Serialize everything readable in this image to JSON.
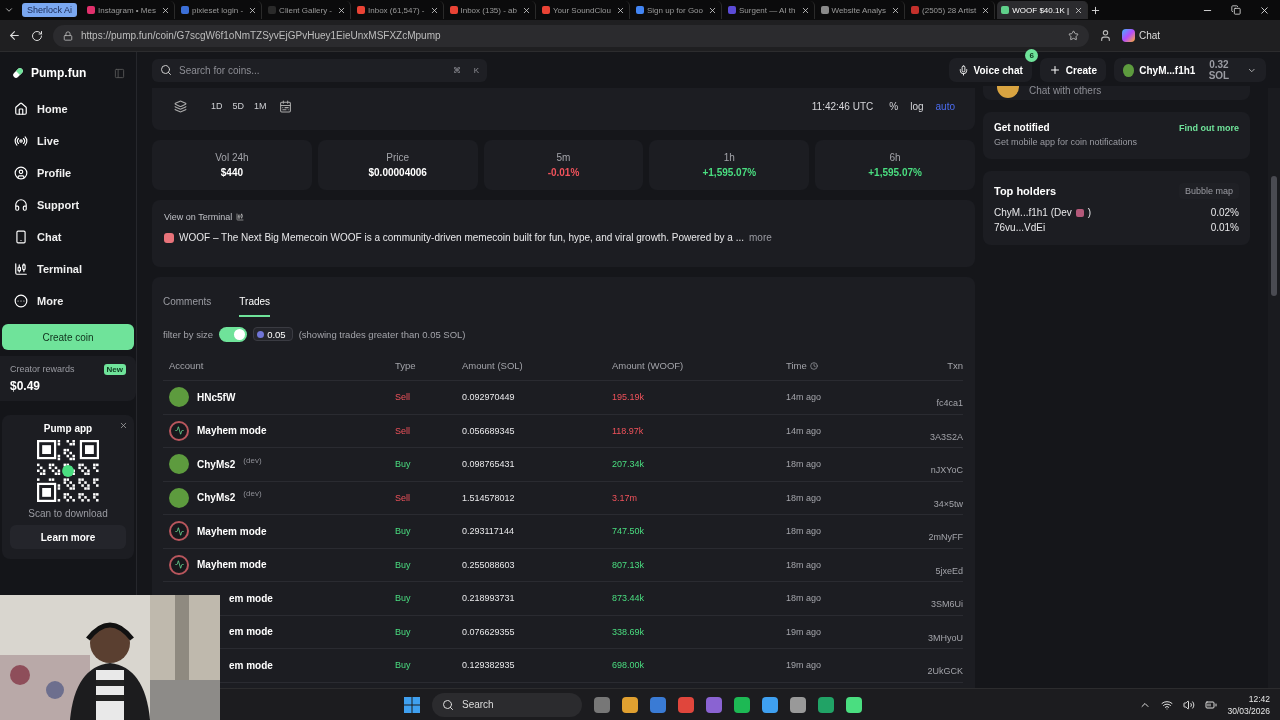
{
  "browser": {
    "group_label": "Sherlock Ai",
    "tabs": [
      {
        "title": "Instagram • Mes",
        "color": "#e1306c",
        "selected": false
      },
      {
        "title": "pixieset login -",
        "color": "#3b6fd8",
        "selected": false
      },
      {
        "title": "Client Gallery -",
        "color": "#2a2a2a",
        "selected": false
      },
      {
        "title": "Inbox (61,547) -",
        "color": "#ea4335",
        "selected": false
      },
      {
        "title": "Inbox (135) - ab",
        "color": "#ea4335",
        "selected": false
      },
      {
        "title": "Your SoundClou",
        "color": "#ea4335",
        "selected": false
      },
      {
        "title": "Sign up for Goo",
        "color": "#4285f4",
        "selected": false
      },
      {
        "title": "Surgent — AI th",
        "color": "#5b4bd6",
        "selected": false
      },
      {
        "title": "Website Analys",
        "color": "#8a8a8a",
        "selected": false
      },
      {
        "title": "(2505) 28 Artist",
        "color": "#c4302b",
        "selected": false
      },
      {
        "title": "WOOF $40.1K |",
        "color": "#5fd08a",
        "selected": true
      }
    ],
    "url": "https://pump.fun/coin/G7scgW6f1oNmTZSyvEjGPvHuey1EieUnxMSFXZcMpump",
    "chat_button": "Chat"
  },
  "sidebar": {
    "logo": "Pump.fun",
    "items": [
      {
        "label": "Home"
      },
      {
        "label": "Live"
      },
      {
        "label": "Profile"
      },
      {
        "label": "Support"
      },
      {
        "label": "Chat"
      },
      {
        "label": "Terminal"
      },
      {
        "label": "More"
      }
    ],
    "create_button": "Create coin",
    "rewards": {
      "label": "Creator rewards",
      "badge": "New",
      "amount": "$0.49"
    },
    "app_card": {
      "title": "Pump app",
      "caption": "Scan to download",
      "button": "Learn more"
    }
  },
  "header": {
    "search_placeholder": "Search for coins...",
    "shortcut": [
      "⌘",
      "K"
    ],
    "voice_chat": "Voice chat",
    "voice_badge": "6",
    "create": "Create",
    "account": "ChyM...f1h1",
    "balance": "0.32 SOL"
  },
  "chart_toolbar": {
    "ranges": [
      "1D",
      "5D",
      "1M"
    ],
    "clock": "11:42:46 UTC",
    "options": [
      {
        "label": "%",
        "selected": false
      },
      {
        "label": "log",
        "selected": false
      },
      {
        "label": "auto",
        "selected": true
      }
    ]
  },
  "stats": [
    {
      "label": "Vol 24h",
      "value": "$440",
      "kind": "neutral"
    },
    {
      "label": "Price",
      "value": "$0.00004006",
      "kind": "neutral"
    },
    {
      "label": "5m",
      "value": "-0.01%",
      "kind": "down"
    },
    {
      "label": "1h",
      "value": "+1,595.07%",
      "kind": "up"
    },
    {
      "label": "6h",
      "value": "+1,595.07%",
      "kind": "up"
    }
  ],
  "description": {
    "link": "View on Terminal",
    "text": "WOOF – The Next Big Memecoin WOOF is a community-driven memecoin built for fun, hype, and viral growth. Powered by a ...",
    "more": "more"
  },
  "trades": {
    "tabs": [
      {
        "label": "Comments",
        "selected": false
      },
      {
        "label": "Trades",
        "selected": true
      }
    ],
    "filter": {
      "label": "filter by size",
      "on": true,
      "value": "0.05",
      "note": "(showing trades greater than 0.05 SOL)"
    },
    "columns": [
      "Account",
      "Type",
      "Amount (SOL)",
      "Amount (WOOF)",
      "Time",
      "Txn"
    ],
    "rows": [
      {
        "avatar": {
          "kind": "frog"
        },
        "account": "HNc5fW",
        "kind": "sell",
        "type": "Sell",
        "sol": "0.092970449",
        "tokens": "195.19k",
        "time": "14m ago",
        "txn": "fc4ca1"
      },
      {
        "avatar": {
          "kind": "pulse"
        },
        "account": "Mayhem mode",
        "kind": "sell",
        "type": "Sell",
        "sol": "0.056689345",
        "tokens": "118.97k",
        "time": "14m ago",
        "txn": "3A3S2A"
      },
      {
        "avatar": {
          "kind": "frog"
        },
        "account": "ChyMs2",
        "note": "(dev)",
        "kind": "buy",
        "type": "Buy",
        "sol": "0.098765431",
        "tokens": "207.34k",
        "time": "18m ago",
        "txn": "nJXYoC"
      },
      {
        "avatar": {
          "kind": "frog"
        },
        "account": "ChyMs2",
        "note": "(dev)",
        "kind": "sell",
        "type": "Sell",
        "sol": "1.514578012",
        "tokens": "3.17m",
        "time": "18m ago",
        "txn": "34×5tw"
      },
      {
        "avatar": {
          "kind": "pulse"
        },
        "account": "Mayhem mode",
        "kind": "buy",
        "type": "Buy",
        "sol": "0.293117144",
        "tokens": "747.50k",
        "time": "18m ago",
        "txn": "2mNyFF"
      },
      {
        "avatar": {
          "kind": "pulse"
        },
        "account": "Mayhem mode",
        "kind": "buy",
        "type": "Buy",
        "sol": "0.255088603",
        "tokens": "807.13k",
        "time": "18m ago",
        "txn": "5jxeEd"
      },
      {
        "account": "em mode",
        "kind": "buy",
        "type": "Buy",
        "sol": "0.218993731",
        "tokens": "873.44k",
        "time": "18m ago",
        "txn": "3SM6Ui"
      },
      {
        "account": "em mode",
        "kind": "buy",
        "type": "Buy",
        "sol": "0.076629355",
        "tokens": "338.69k",
        "time": "19m ago",
        "txn": "3MHyoU"
      },
      {
        "account": "em mode",
        "kind": "buy",
        "type": "Buy",
        "sol": "0.129382935",
        "tokens": "698.00k",
        "time": "19m ago",
        "txn": "2UkGCK"
      }
    ]
  },
  "right": {
    "chat_card": {
      "text": "Chat with others"
    },
    "notify": {
      "title": "Get notified",
      "text": "Get mobile app for coin notifications",
      "link": "Find out more"
    },
    "holders": {
      "title": "Top holders",
      "button": "Bubble map",
      "rows": [
        {
          "name": "ChyM...f1h1 (Dev",
          "note_end": ")",
          "dev": true,
          "pct": "0.02%"
        },
        {
          "name": "76vu...VdEi",
          "dev": false,
          "pct": "0.01%"
        }
      ]
    }
  },
  "taskbar": {
    "search": "Search",
    "time": "12:42",
    "date": "30/03/2026"
  }
}
